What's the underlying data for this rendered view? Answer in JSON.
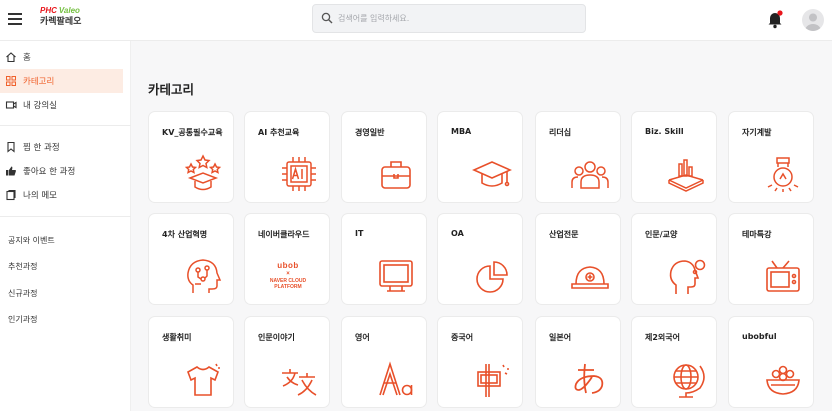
{
  "header": {
    "logo_phc": "PHC",
    "logo_valeo": "Valeo",
    "logo_name": "카렉팔레오",
    "search_placeholder": "검색어를 입력하세요."
  },
  "sidebar": {
    "primary": [
      {
        "label": "홈",
        "icon": "home-icon"
      },
      {
        "label": "카테고리",
        "icon": "grid-icon",
        "active": true
      },
      {
        "label": "내 강의실",
        "icon": "classroom-icon"
      }
    ],
    "secondary": [
      {
        "label": "찜 한 과정",
        "icon": "bookmark-icon"
      },
      {
        "label": "좋아요 한 과정",
        "icon": "thumbs-up-icon"
      },
      {
        "label": "나의 메모",
        "icon": "memo-icon"
      }
    ],
    "links": [
      "공지와 이벤트",
      "추천과정",
      "신규과정",
      "인기과정"
    ]
  },
  "main": {
    "title": "카테고리",
    "categories": [
      {
        "label": "KV_공통필수교육",
        "icon": "stars-hat-icon"
      },
      {
        "label": "AI 추천교육",
        "icon": "ai-chip-icon"
      },
      {
        "label": "경영일반",
        "icon": "briefcase-icon"
      },
      {
        "label": "MBA",
        "icon": "graduation-cap-icon"
      },
      {
        "label": "리더십",
        "icon": "team-icon"
      },
      {
        "label": "Biz. Skill",
        "icon": "book-chart-icon"
      },
      {
        "label": "자기계발",
        "icon": "lightbulb-icon"
      },
      {
        "label": "4차 산업혁명",
        "icon": "head-circuit-icon"
      },
      {
        "label": "네이버클라우드",
        "icon": "naver-cloud-logo",
        "logo": [
          "ubob",
          "×",
          "NAVER CLOUD",
          "PLATFORM"
        ]
      },
      {
        "label": "IT",
        "icon": "monitor-icon"
      },
      {
        "label": "OA",
        "icon": "pie-chart-icon"
      },
      {
        "label": "산업전문",
        "icon": "hardhat-icon"
      },
      {
        "label": "인문/교양",
        "icon": "head-thought-icon"
      },
      {
        "label": "테마특강",
        "icon": "tv-icon"
      },
      {
        "label": "생활취미",
        "icon": "tshirt-icon"
      },
      {
        "label": "인문이야기",
        "icon": "translate-icon"
      },
      {
        "label": "영어",
        "icon": "alphabet-icon"
      },
      {
        "label": "중국어",
        "icon": "chinese-char-icon"
      },
      {
        "label": "일본어",
        "icon": "hiragana-icon"
      },
      {
        "label": "제2외국어",
        "icon": "globe-icon"
      },
      {
        "label": "ubobful",
        "icon": "bowl-icon"
      }
    ]
  },
  "colors": {
    "accent": "#f0612b",
    "active_bg": "#fdece3",
    "icon": "#e8502a",
    "notification": "#e8151b"
  }
}
